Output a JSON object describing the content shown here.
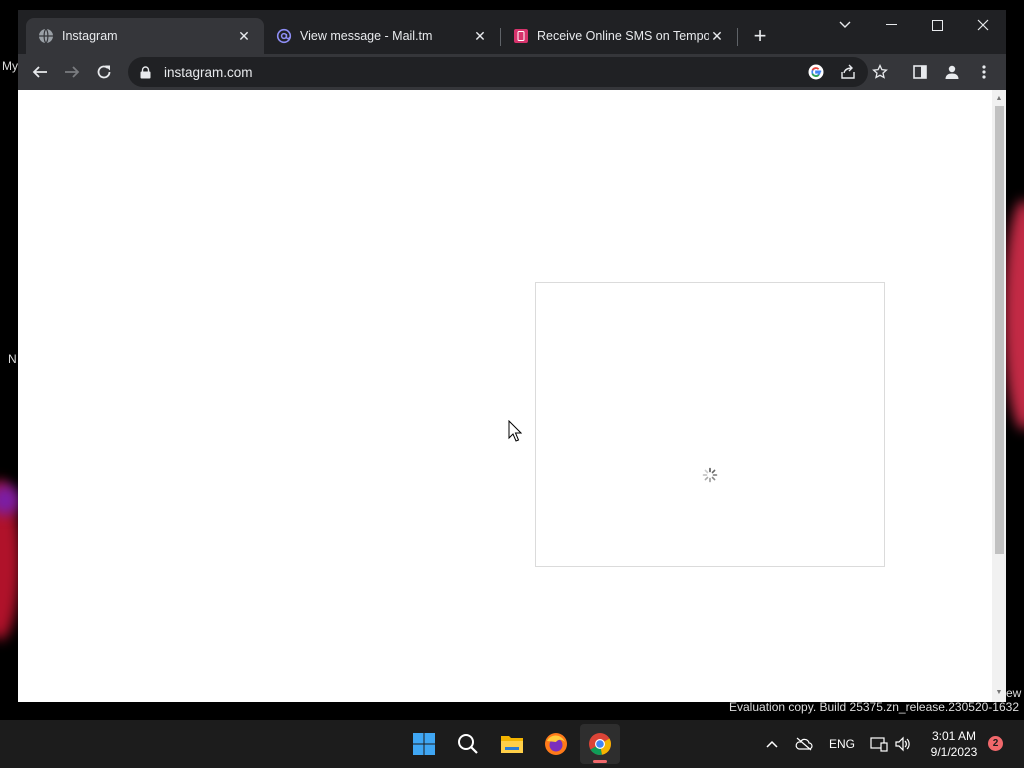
{
  "desktop": {
    "label_my": "My",
    "label_n": "N",
    "label_ew": "ew"
  },
  "browser": {
    "tabs": [
      {
        "title": "Instagram",
        "favicon": "globe-icon",
        "active": true
      },
      {
        "title": "View message - Mail.tm",
        "favicon": "at-sign-icon",
        "active": false
      },
      {
        "title": "Receive Online SMS on Tempora",
        "favicon": "sms-site-icon",
        "active": false
      }
    ],
    "new_tab_label": "+",
    "address": "instagram.com",
    "accent": "#8ab4f8"
  },
  "page": {
    "content": "loading"
  },
  "watermark": {
    "text": "Evaluation copy. Build 25375.zn_release.230520-1632"
  },
  "taskbar": {
    "apps": [
      "start-icon",
      "search-icon",
      "file-explorer-icon",
      "firefox-icon",
      "chrome-icon"
    ],
    "active_app": "chrome-icon",
    "language": "ENG",
    "time": "3:01 AM",
    "date": "9/1/2023",
    "notification_count": "2"
  }
}
